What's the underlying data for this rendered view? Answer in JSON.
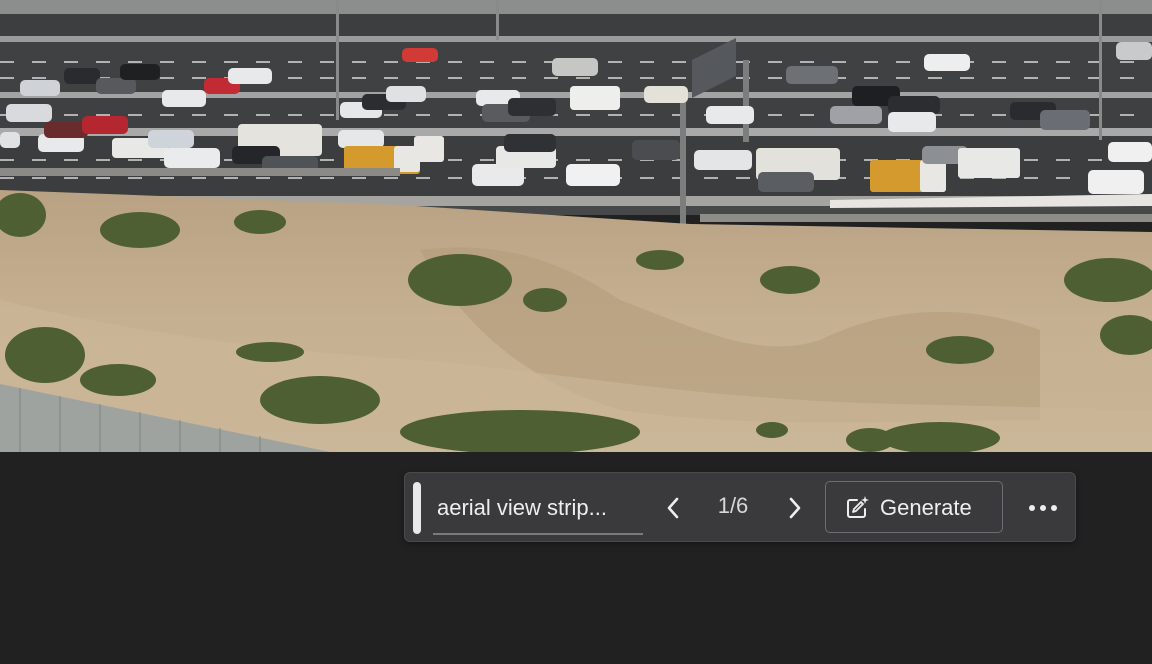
{
  "toolbar": {
    "prompt_text": "aerial view strip...",
    "page_counter": "1/6",
    "generate_label": "Generate"
  },
  "icons": {
    "drag": "drag-handle",
    "prev": "chevron-left-icon",
    "next": "chevron-right-icon",
    "generate": "edit-sparkle-icon",
    "more": "more-horizontal-icon"
  },
  "colors": {
    "app_background": "#212122",
    "toolbar_background": "#3a3a3c",
    "toolbar_text": "#eeeeee",
    "button_border": "#6e6e72"
  }
}
